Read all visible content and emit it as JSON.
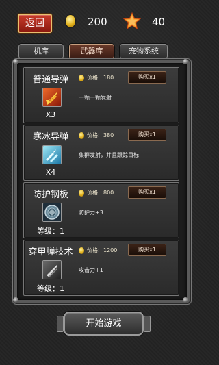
{
  "topbar": {
    "back_label": "返回",
    "gold_icon": "gold-coin-icon",
    "gold": "200",
    "star_icon": "star-icon",
    "stars": "40"
  },
  "tabs": [
    {
      "label": "机库",
      "active": false
    },
    {
      "label": "武器库",
      "active": true
    },
    {
      "label": "宠物系统",
      "active": false
    }
  ],
  "items": [
    {
      "name": "普通导弹",
      "icon": "missile-icon",
      "sub": "X3",
      "price_label": "价格:",
      "price": "180",
      "buy_label": "购买x1",
      "desc": "一颗一颗发射"
    },
    {
      "name": "寒冰导弹",
      "icon": "ice-missile-icon",
      "sub": "X4",
      "price_label": "价格:",
      "price": "380",
      "buy_label": "购买x1",
      "desc": "集群发射，并且跟踪目标"
    },
    {
      "name": "防护钢板",
      "icon": "armor-plate-icon",
      "sub": "等级：1",
      "price_label": "价格:",
      "price": "800",
      "buy_label": "购买x1",
      "desc": "防护力+3"
    },
    {
      "name": "穿甲弹技术",
      "icon": "armor-piercing-icon",
      "sub": "等级：1",
      "price_label": "价格:",
      "price": "1200",
      "buy_label": "购买x1",
      "desc": "攻击力+1"
    }
  ],
  "start_label": "开始游戏",
  "colors": {
    "back_button": "#b02a1a",
    "active_tab": "#5a2e20",
    "gold": "#e3b21c"
  }
}
